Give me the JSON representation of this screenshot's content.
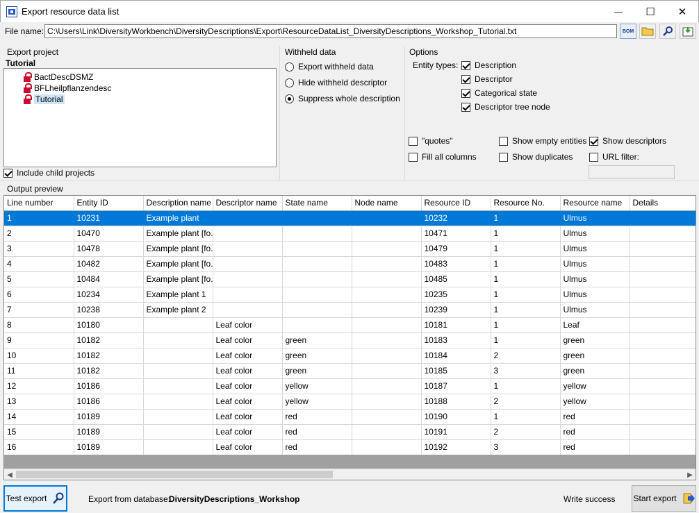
{
  "window": {
    "title": "Export resource data list",
    "minimize": "—",
    "maximize": "☐",
    "close": "✕"
  },
  "file": {
    "label": "File name:",
    "path": "C:\\Users\\Link\\DiversityWorkbench\\DiversityDescriptions\\Export\\ResourceDataList_DiversityDescriptions_Workshop_Tutorial.txt",
    "bom_label": "BOM"
  },
  "project": {
    "group_label": "Export project",
    "current": "Tutorial",
    "items": [
      "BactDescDSMZ",
      "BFLheilpflanzendesc",
      "Tutorial"
    ],
    "include_child": "Include child projects"
  },
  "withheld": {
    "group_label": "Withheld data",
    "options": [
      "Export withheld data",
      "Hide withheld descriptor",
      "Suppress whole description"
    ],
    "selected": "Suppress whole description"
  },
  "options": {
    "group_label": "Options",
    "entity_types_label": "Entity types:",
    "entity_types": [
      "Description",
      "Descriptor",
      "Categorical state",
      "Descriptor tree node"
    ],
    "quotes": "\"quotes\"",
    "fill_all_columns": "Fill all columns",
    "show_empty_entities": "Show empty entities",
    "show_duplicates": "Show duplicates",
    "show_descriptors": "Show descriptors",
    "url_filter": "URL filter:",
    "url_filter_value": ""
  },
  "preview": {
    "label": "Output preview",
    "columns": [
      "Line number",
      "Entity ID",
      "Description name",
      "Descriptor name",
      "State name",
      "Node name",
      "Resource ID",
      "Resource No.",
      "Resource name",
      "Details"
    ],
    "rows": [
      [
        "1",
        "10231",
        "Example plant",
        "",
        "",
        "",
        "10232",
        "1",
        "Ulmus",
        ""
      ],
      [
        "2",
        "10470",
        "Example plant [fo...",
        "",
        "",
        "",
        "10471",
        "1",
        "Ulmus",
        ""
      ],
      [
        "3",
        "10478",
        "Example plant [fo...",
        "",
        "",
        "",
        "10479",
        "1",
        "Ulmus",
        ""
      ],
      [
        "4",
        "10482",
        "Example plant [fo...",
        "",
        "",
        "",
        "10483",
        "1",
        "Ulmus",
        ""
      ],
      [
        "5",
        "10484",
        "Example plant [fo...",
        "",
        "",
        "",
        "10485",
        "1",
        "Ulmus",
        ""
      ],
      [
        "6",
        "10234",
        "Example plant 1",
        "",
        "",
        "",
        "10235",
        "1",
        "Ulmus",
        ""
      ],
      [
        "7",
        "10238",
        "Example plant 2",
        "",
        "",
        "",
        "10239",
        "1",
        "Ulmus",
        ""
      ],
      [
        "8",
        "10180",
        "",
        "Leaf color",
        "",
        "",
        "10181",
        "1",
        "Leaf",
        ""
      ],
      [
        "9",
        "10182",
        "",
        "Leaf color",
        "green",
        "",
        "10183",
        "1",
        "green",
        ""
      ],
      [
        "10",
        "10182",
        "",
        "Leaf color",
        "green",
        "",
        "10184",
        "2",
        "green",
        ""
      ],
      [
        "11",
        "10182",
        "",
        "Leaf color",
        "green",
        "",
        "10185",
        "3",
        "green",
        ""
      ],
      [
        "12",
        "10186",
        "",
        "Leaf color",
        "yellow",
        "",
        "10187",
        "1",
        "yellow",
        ""
      ],
      [
        "13",
        "10186",
        "",
        "Leaf color",
        "yellow",
        "",
        "10188",
        "2",
        "yellow",
        ""
      ],
      [
        "14",
        "10189",
        "",
        "Leaf color",
        "red",
        "",
        "10190",
        "1",
        "red",
        ""
      ],
      [
        "15",
        "10189",
        "",
        "Leaf color",
        "red",
        "",
        "10191",
        "2",
        "red",
        ""
      ],
      [
        "16",
        "10189",
        "",
        "Leaf color",
        "red",
        "",
        "10192",
        "3",
        "red",
        ""
      ]
    ]
  },
  "footer": {
    "test_export": "Test export",
    "export_from_label": "Export from database:",
    "database": "DiversityDescriptions_Workshop",
    "status": "Write success",
    "start_export": "Start export"
  },
  "colors": {
    "selection": "#0078d7",
    "window_bg": "#f0f0f0"
  }
}
